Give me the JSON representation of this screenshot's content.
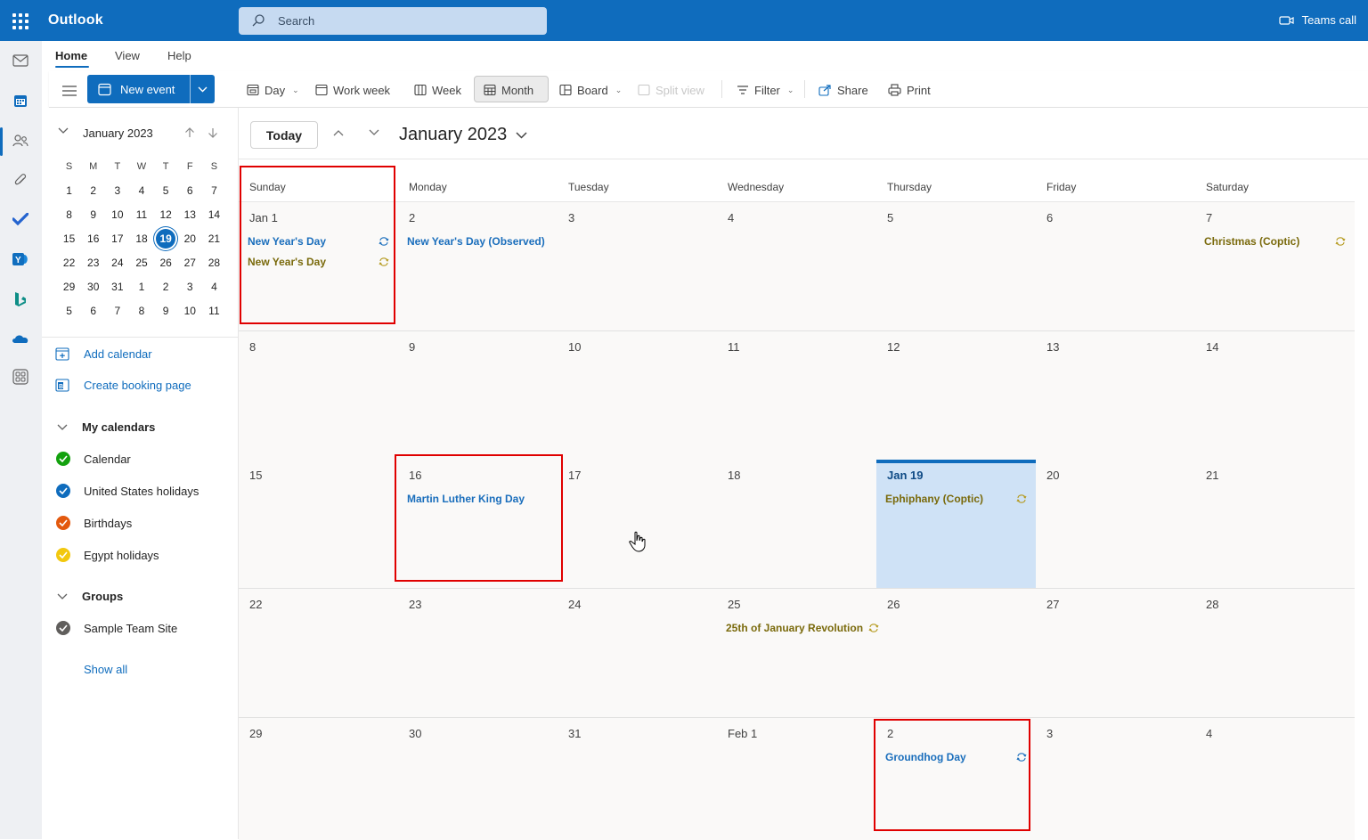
{
  "app": {
    "name": "Outlook",
    "search_placeholder": "Search",
    "teams_call": "Teams call"
  },
  "tabs": [
    {
      "label": "Home",
      "active": true
    },
    {
      "label": "View"
    },
    {
      "label": "Help"
    }
  ],
  "ribbon": {
    "new_event": "New event",
    "day": "Day",
    "work_week": "Work week",
    "week": "Week",
    "month": "Month",
    "board": "Board",
    "split_view": "Split view",
    "filter": "Filter",
    "share": "Share",
    "print": "Print"
  },
  "mini_calendar": {
    "title": "January 2023",
    "weekday_headers": [
      "S",
      "M",
      "T",
      "W",
      "T",
      "F",
      "S"
    ],
    "weeks": [
      [
        "1",
        "2",
        "3",
        "4",
        "5",
        "6",
        "7"
      ],
      [
        "8",
        "9",
        "10",
        "11",
        "12",
        "13",
        "14"
      ],
      [
        "15",
        "16",
        "17",
        "18",
        "19",
        "20",
        "21"
      ],
      [
        "22",
        "23",
        "24",
        "25",
        "26",
        "27",
        "28"
      ],
      [
        "29",
        "30",
        "31",
        "1",
        "2",
        "3",
        "4"
      ],
      [
        "5",
        "6",
        "7",
        "8",
        "9",
        "10",
        "11"
      ]
    ],
    "selected": "19"
  },
  "sidebar": {
    "add_calendar": "Add calendar",
    "create_booking_page": "Create booking page",
    "my_calendars_label": "My calendars",
    "calendars": [
      {
        "name": "Calendar",
        "color": "#13a10e"
      },
      {
        "name": "United States holidays",
        "color": "#0f6cbd"
      },
      {
        "name": "Birthdays",
        "color": "#e3590e"
      },
      {
        "name": "Egypt holidays",
        "color": "#f2c80f"
      }
    ],
    "groups_label": "Groups",
    "groups": [
      {
        "name": "Sample Team Site",
        "color": "#605e5c"
      }
    ],
    "show_all": "Show all"
  },
  "main": {
    "today_button": "Today",
    "month_title": "January 2023",
    "day_names": [
      "Sunday",
      "Monday",
      "Tuesday",
      "Wednesday",
      "Thursday",
      "Friday",
      "Saturday"
    ],
    "weeks": [
      [
        {
          "label": "Jan 1",
          "events": [
            {
              "title": "New Year's Day",
              "style": "blue",
              "recurring": true
            },
            {
              "title": "New Year's Day",
              "style": "olive",
              "recurring": true
            }
          ]
        },
        {
          "label": "2",
          "events": [
            {
              "title": "New Year's Day (Observed)",
              "style": "blue",
              "recurring": false
            }
          ]
        },
        {
          "label": "3",
          "events": []
        },
        {
          "label": "4",
          "events": []
        },
        {
          "label": "5",
          "events": []
        },
        {
          "label": "6",
          "events": []
        },
        {
          "label": "7",
          "events": [
            {
              "title": "Christmas (Coptic)",
              "style": "olive",
              "recurring": true
            }
          ]
        }
      ],
      [
        {
          "label": "8",
          "events": []
        },
        {
          "label": "9",
          "events": []
        },
        {
          "label": "10",
          "events": []
        },
        {
          "label": "11",
          "events": []
        },
        {
          "label": "12",
          "events": []
        },
        {
          "label": "13",
          "events": []
        },
        {
          "label": "14",
          "events": []
        }
      ],
      [
        {
          "label": "15",
          "events": []
        },
        {
          "label": "16",
          "events": [
            {
              "title": "Martin Luther King Day",
              "style": "blue",
              "recurring": false
            }
          ]
        },
        {
          "label": "17",
          "events": []
        },
        {
          "label": "18",
          "events": []
        },
        {
          "label": "Jan 19",
          "today": true,
          "events": [
            {
              "title": "Ephiphany (Coptic)",
              "style": "olive",
              "recurring": true
            }
          ]
        },
        {
          "label": "20",
          "events": []
        },
        {
          "label": "21",
          "events": []
        }
      ],
      [
        {
          "label": "22",
          "events": []
        },
        {
          "label": "23",
          "events": []
        },
        {
          "label": "24",
          "events": []
        },
        {
          "label": "25",
          "events": [
            {
              "title": "25th of January Revolution",
              "style": "olive",
              "recurring": true
            }
          ]
        },
        {
          "label": "26",
          "events": []
        },
        {
          "label": "27",
          "events": []
        },
        {
          "label": "28",
          "events": []
        }
      ],
      [
        {
          "label": "29",
          "events": []
        },
        {
          "label": "30",
          "events": []
        },
        {
          "label": "31",
          "events": []
        },
        {
          "label": "Feb 1",
          "events": []
        },
        {
          "label": "2",
          "events": [
            {
              "title": "Groundhog Day",
              "style": "blue",
              "recurring": true
            }
          ]
        },
        {
          "label": "3",
          "events": []
        },
        {
          "label": "4",
          "events": []
        }
      ]
    ]
  },
  "colors": {
    "brand": "#0f6cbd",
    "today_fill": "#cfe2f6",
    "highlight_box": "#e00000"
  }
}
